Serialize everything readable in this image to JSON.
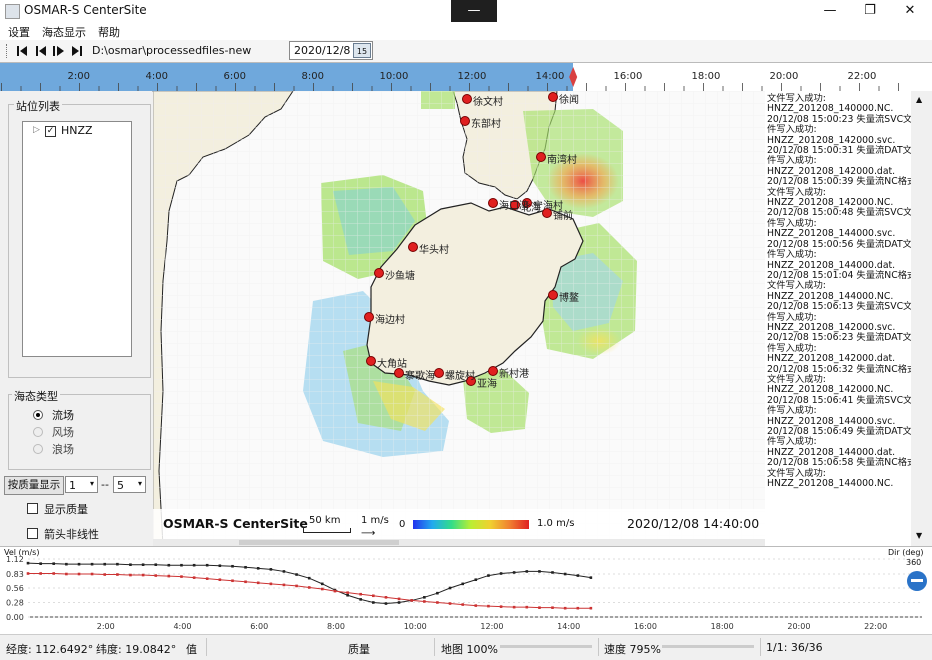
{
  "window": {
    "title": "OSMAR-S CenterSite",
    "controls": [
      "—",
      "❐",
      "✕"
    ]
  },
  "menu": [
    "设置",
    "海态显示",
    "帮助"
  ],
  "toolbar": {
    "path": "D:\\osmar\\processedfiles-new",
    "date": "2020/12/8",
    "calendar_day": "15",
    "nav_icons": [
      "first-icon",
      "prev-icon",
      "play-icon",
      "last-icon"
    ]
  },
  "timeline": {
    "ticks": [
      "2:00",
      "4:00",
      "6:00",
      "8:00",
      "10:00",
      "12:00",
      "14:00",
      "16:00",
      "18:00",
      "20:00",
      "22:00"
    ],
    "played_fraction": 0.615,
    "color": "#6fa8dc"
  },
  "station_panel": {
    "title": "站位列表",
    "tree_root": "HNZZ",
    "checked": true
  },
  "sea_state": {
    "title": "海态类型",
    "options": [
      {
        "label": "流场",
        "selected": true,
        "enabled": true
      },
      {
        "label": "风场",
        "selected": false,
        "enabled": false
      },
      {
        "label": "浪场",
        "selected": false,
        "enabled": false
      }
    ]
  },
  "quality": {
    "button": "按质量显示",
    "from": "1",
    "dash": "--",
    "to": "5",
    "show_quality": "显示质量",
    "arrow_nonlinear": "箭头非线性"
  },
  "map": {
    "brand": "OSMAR-S CenterSite",
    "scale_km": "50 km",
    "scale_speed": "1 m/s",
    "legend_min": "0",
    "legend_max": "1.0 m/s",
    "timestamp": "2020/12/08 14:40:00",
    "stations": [
      "徐文村",
      "东部村",
      "徐闻",
      "南湾村",
      "海口湾",
      "北海",
      "宁海村",
      "铺前",
      "华头村",
      "沙鱼塘",
      "海边村",
      "大角站",
      "寨歌海",
      "螺旋村",
      "亚海",
      "新村港",
      "博鳌"
    ]
  },
  "log_lines": [
    "文件写入成功:",
    "HNZZ_201208_140000.NC.",
    "20/12/08 15:00:23 失量流SVC文",
    "件写入成功:",
    "HNZZ_201208_142000.svc.",
    "20/12/08 15:00:31 失量流DAT文",
    "件写入成功:",
    "HNZZ_201208_142000.dat.",
    "20/12/08 15:00:39 失量流NC格式",
    "文件写入成功:",
    "HNZZ_201208_142000.NC.",
    "20/12/08 15:00:48 失量流SVC文",
    "件写入成功:",
    "HNZZ_201208_144000.svc.",
    "20/12/08 15:00:56 失量流DAT文",
    "件写入成功:",
    "HNZZ_201208_144000.dat.",
    "20/12/08 15:01:04 失量流NC格式",
    "文件写入成功:",
    "HNZZ_201208_144000.NC.",
    "20/12/08 15:06:13 失量流SVC文",
    "件写入成功:",
    "HNZZ_201208_142000.svc.",
    "20/12/08 15:06:23 失量流DAT文",
    "件写入成功:",
    "HNZZ_201208_142000.dat.",
    "20/12/08 15:06:32 失量流NC格式",
    "文件写入成功:",
    "HNZZ_201208_142000.NC.",
    "20/12/08 15:06:41 失量流SVC文",
    "件写入成功:",
    "HNZZ_201208_144000.svc.",
    "20/12/08 15:06:49 失量流DAT文",
    "件写入成功:",
    "HNZZ_201208_144000.dat.",
    "20/12/08 15:06:58 失量流NC格式",
    "文件写入成功:",
    "HNZZ_201208_144000.NC."
  ],
  "chart_data": {
    "type": "line",
    "ylabel_left": "Vel (m/s)",
    "ylabel_right": "Dir (deg)",
    "right_top": "360",
    "yticks": [
      "1.12",
      "0.83",
      "0.56",
      "0.28",
      "0.00"
    ],
    "xticks": [
      "2:00",
      "4:00",
      "6:00",
      "8:00",
      "10:00",
      "12:00",
      "14:00",
      "16:00",
      "18:00",
      "20:00",
      "22:00"
    ],
    "x": [
      0,
      0.33,
      0.67,
      1,
      1.33,
      1.67,
      2,
      2.33,
      2.67,
      3,
      3.33,
      3.67,
      4,
      4.33,
      4.67,
      5,
      5.33,
      5.67,
      6,
      6.33,
      6.67,
      7,
      7.33,
      7.67,
      8,
      8.33,
      8.67,
      9,
      9.33,
      9.67,
      10,
      10.33,
      10.67,
      11,
      11.33,
      11.67,
      12,
      12.33,
      12.67,
      13,
      13.33,
      13.67,
      14,
      14.33,
      14.67
    ],
    "series": [
      {
        "color": "#222222",
        "values": [
          1.04,
          1.03,
          1.03,
          1.02,
          1.02,
          1.02,
          1.02,
          1.02,
          1.01,
          1.01,
          1.01,
          1.0,
          1.0,
          1.0,
          1.0,
          0.99,
          0.98,
          0.96,
          0.94,
          0.92,
          0.88,
          0.82,
          0.75,
          0.64,
          0.52,
          0.42,
          0.34,
          0.28,
          0.26,
          0.28,
          0.32,
          0.38,
          0.46,
          0.56,
          0.64,
          0.72,
          0.8,
          0.84,
          0.86,
          0.88,
          0.88,
          0.86,
          0.83,
          0.8,
          0.76
        ]
      },
      {
        "color": "#cc3333",
        "values": [
          0.84,
          0.84,
          0.84,
          0.83,
          0.83,
          0.83,
          0.82,
          0.82,
          0.81,
          0.81,
          0.8,
          0.79,
          0.78,
          0.76,
          0.74,
          0.72,
          0.7,
          0.68,
          0.66,
          0.64,
          0.62,
          0.6,
          0.57,
          0.54,
          0.5,
          0.47,
          0.44,
          0.41,
          0.38,
          0.35,
          0.32,
          0.3,
          0.28,
          0.26,
          0.24,
          0.22,
          0.21,
          0.2,
          0.19,
          0.19,
          0.18,
          0.18,
          0.17,
          0.17,
          0.17
        ]
      }
    ],
    "xlim": [
      0,
      23.3
    ],
    "ylim": [
      0,
      1.12
    ]
  },
  "status": {
    "lon": "经度: 112.6492°",
    "lat": "纬度: 19.0842°",
    "value_label": "值",
    "quality_label": "质量",
    "map_zoom": "地图 100%",
    "speed": "速度 795%",
    "frame": "1/1: 36/36"
  }
}
